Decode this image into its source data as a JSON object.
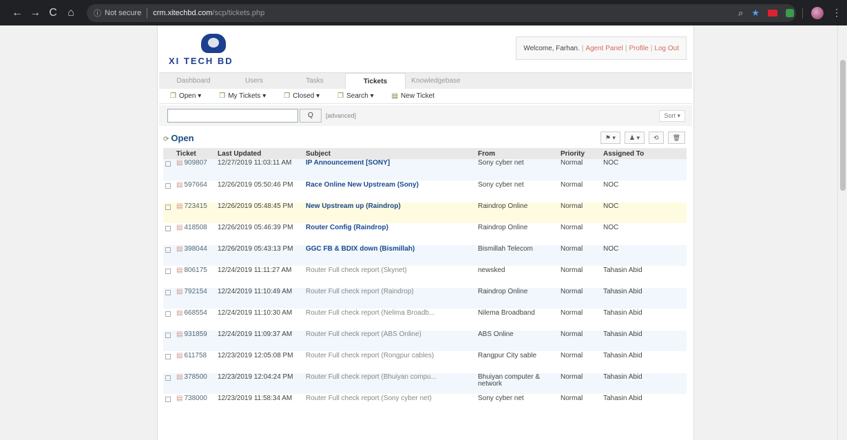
{
  "browser": {
    "security_label": "Not secure",
    "url_host": "crm.xitechbd.com",
    "url_path": "/scp/tickets.php"
  },
  "logo": {
    "wordmark": "XI TECH BD"
  },
  "welcome": {
    "text": "Welcome, Farhan.",
    "agent_panel": "Agent Panel",
    "profile": "Profile",
    "logout": "Log Out",
    "sep": "|"
  },
  "tabs": [
    "Dashboard",
    "Users",
    "Tasks",
    "Tickets",
    "Knowledgebase"
  ],
  "subnav": [
    "Open ▾",
    "My Tickets ▾",
    "Closed ▾",
    "Search ▾",
    "New Ticket"
  ],
  "search": {
    "button": "Q",
    "advanced": "[advanced]",
    "sort": "Sort ▾"
  },
  "list": {
    "title": "Open",
    "actions": [
      "⚑ ▾",
      "♟ ▾",
      "⟲",
      "🗑"
    ]
  },
  "columns": [
    "Ticket",
    "Last Updated",
    "Subject",
    "From",
    "Priority",
    "Assigned To"
  ],
  "tickets": [
    {
      "number": "909807",
      "updated": "12/27/2019 11:03:11 AM",
      "subject": "IP Announcement [SONY]",
      "from": "Sony cyber net",
      "priority": "Normal",
      "assigned": "NOC",
      "style": "new"
    },
    {
      "number": "597664",
      "updated": "12/26/2019 05:50:46 PM",
      "subject": "Race Online New Upstream (Sony)",
      "from": "Sony cyber net",
      "priority": "Normal",
      "assigned": "NOC",
      "style": "new"
    },
    {
      "number": "723415",
      "updated": "12/26/2019 05:48:45 PM",
      "subject": "New Upstream up (Raindrop)",
      "from": "Raindrop Online",
      "priority": "Normal",
      "assigned": "NOC",
      "style": "new"
    },
    {
      "number": "418508",
      "updated": "12/26/2019 05:46:39 PM",
      "subject": "Router Config (Raindrop)",
      "from": "Raindrop Online",
      "priority": "Normal",
      "assigned": "NOC",
      "style": "new"
    },
    {
      "number": "398044",
      "updated": "12/26/2019 05:43:13 PM",
      "subject": "GGC FB & BDIX down (Bismillah)",
      "from": "Bismillah Telecom",
      "priority": "Normal",
      "assigned": "NOC",
      "style": "new"
    },
    {
      "number": "806175",
      "updated": "12/24/2019 11:11:27 AM",
      "subject": "Router Full check report (Skynet)",
      "from": "newsked",
      "priority": "Normal",
      "assigned": "Tahasin Abid",
      "style": "read"
    },
    {
      "number": "792154",
      "updated": "12/24/2019 11:10:49 AM",
      "subject": "Router Full check report (Raindrop)",
      "from": "Raindrop Online",
      "priority": "Normal",
      "assigned": "Tahasin Abid",
      "style": "read"
    },
    {
      "number": "668554",
      "updated": "12/24/2019 11:10:30 AM",
      "subject": "Router Full check report (Nelima Broadb...",
      "from": "Nilema Broadband",
      "priority": "Normal",
      "assigned": "Tahasin Abid",
      "style": "read"
    },
    {
      "number": "931859",
      "updated": "12/24/2019 11:09:37 AM",
      "subject": "Router Full check report (ABS Online)",
      "from": "ABS Online",
      "priority": "Normal",
      "assigned": "Tahasin Abid",
      "style": "read"
    },
    {
      "number": "611758",
      "updated": "12/23/2019 12:05:08 PM",
      "subject": "Router Full check report (Rongpur cables)",
      "from": "Rangpur City sable",
      "priority": "Normal",
      "assigned": "Tahasin Abid",
      "style": "read"
    },
    {
      "number": "378500",
      "updated": "12/23/2019 12:04:24 PM",
      "subject": "Router Full check report (Bhuiyan compu...",
      "from": "Bhuiyan computer & network",
      "priority": "Normal",
      "assigned": "Tahasin Abid",
      "style": "read"
    },
    {
      "number": "738000",
      "updated": "12/23/2019 11:58:34 AM",
      "subject": "Router Full check report (Sony cyber net)",
      "from": "Sony cyber net",
      "priority": "Normal",
      "assigned": "Tahasin Abid",
      "style": "read"
    }
  ]
}
